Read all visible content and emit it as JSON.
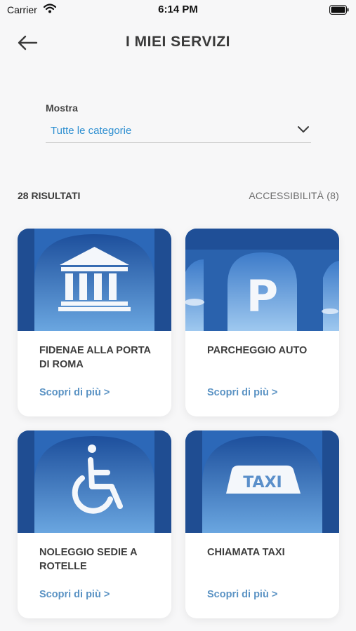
{
  "status_bar": {
    "carrier": "Carrier",
    "time": "6:14 PM"
  },
  "header": {
    "title": "I MIEI SERVIZI",
    "back_icon": "arrow-left-icon"
  },
  "filter": {
    "label": "Mostra",
    "selected": "Tutte le categorie",
    "dropdown_icon": "chevron-down-icon"
  },
  "results": {
    "count_label": "28 RISULTATI",
    "accessibility_filter": "ACCESSIBILITÀ (8)"
  },
  "cards": [
    {
      "title": "FIDENAE ALLA PORTA DI ROMA",
      "link": "Scopri di più >",
      "icon": "museum-icon"
    },
    {
      "title": "PARCHEGGIO AUTO",
      "link": "Scopri di più >",
      "icon": "parking-icon"
    },
    {
      "title": "NOLEGGIO SEDIE A ROTELLE",
      "link": "Scopri di più >",
      "icon": "wheelchair-icon"
    },
    {
      "title": "CHIAMATA TAXI",
      "link": "Scopri di più >",
      "icon": "taxi-icon",
      "image_text": "TAXI"
    }
  ],
  "colors": {
    "accent": "#2e8fd1",
    "link": "#5b93c4",
    "sky_dark": "#1d4f9c",
    "sky_light": "#7fb4e6"
  }
}
